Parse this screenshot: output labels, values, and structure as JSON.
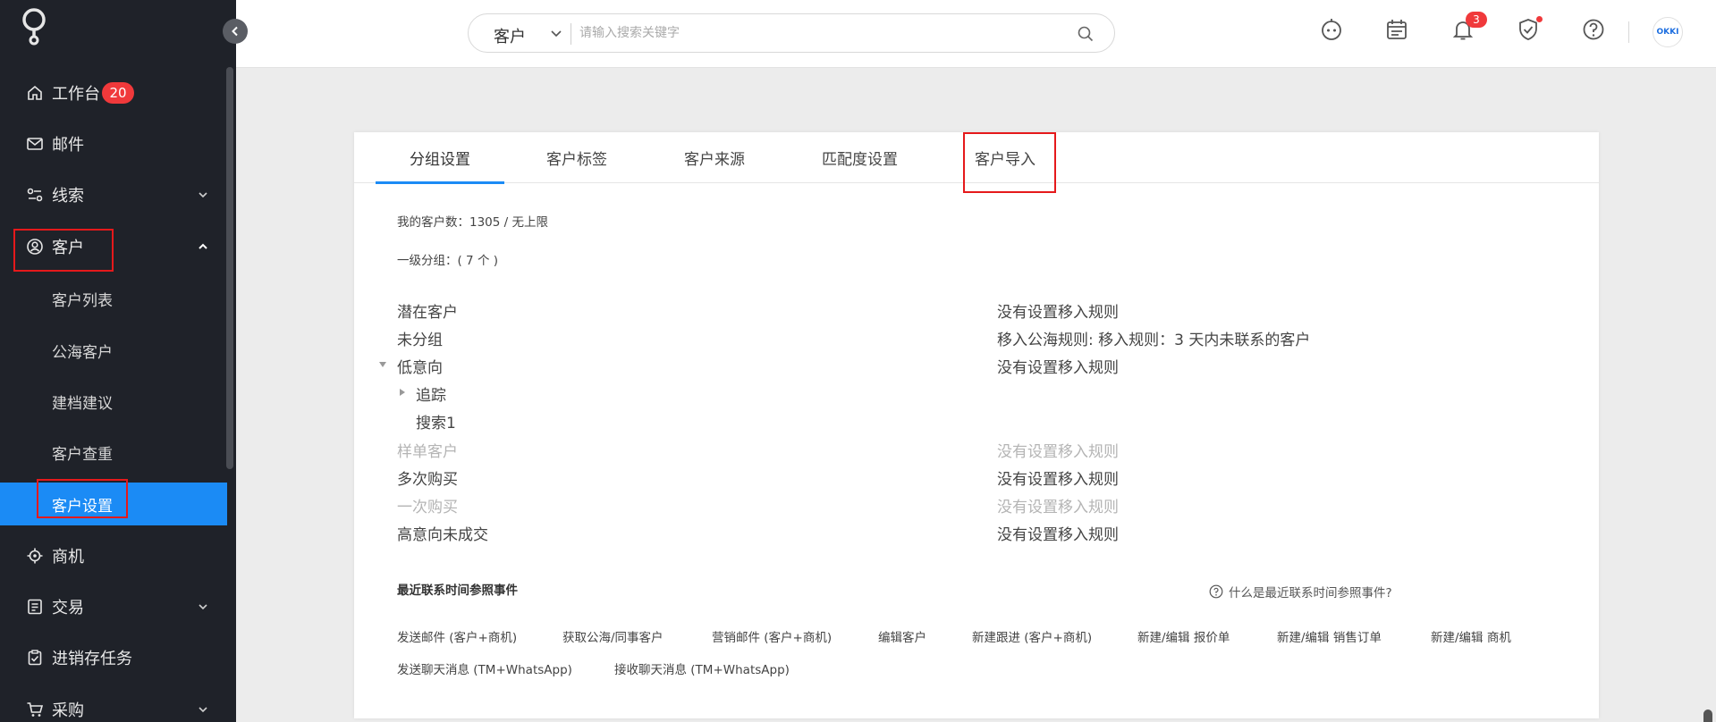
{
  "sidebar": {
    "logo_icon": "okki-logo-icon",
    "items": [
      {
        "label": "工作台",
        "icon": "home-icon",
        "badge": "20"
      },
      {
        "label": "邮件",
        "icon": "mail-icon"
      },
      {
        "label": "线索",
        "icon": "leads-icon",
        "chevron": "down"
      },
      {
        "label": "客户",
        "icon": "customer-icon",
        "chevron": "up"
      },
      {
        "label": "商机",
        "icon": "opportunity-icon"
      },
      {
        "label": "交易",
        "icon": "transaction-icon",
        "chevron": "down"
      },
      {
        "label": "进销存任务",
        "icon": "inventory-task-icon"
      },
      {
        "label": "采购",
        "icon": "cart-icon",
        "chevron": "down"
      }
    ],
    "sub_items": [
      "客户列表",
      "公海客户",
      "建档建议",
      "客户查重",
      "客户设置"
    ],
    "active_sub_item": "客户设置"
  },
  "topbar": {
    "search_scope": "客户",
    "search_placeholder": "请输入搜索关键字",
    "notification_count": "3",
    "avatar_text": "OKKI"
  },
  "tabs": [
    "分组设置",
    "客户标签",
    "客户来源",
    "匹配度设置",
    "客户导入"
  ],
  "active_tab": "分组设置",
  "stats": {
    "customer_count": "我的客户数：1305 / 无上限",
    "level1_groups": "一级分组：( 7 个 )"
  },
  "groups": [
    {
      "name": "潜在客户",
      "rule": "没有设置移入规则",
      "muted": false
    },
    {
      "name": "未分组",
      "rule": "移入公海规则: 移入规则：3 天内未联系的客户",
      "muted": false
    },
    {
      "name": "低意向",
      "rule": "没有设置移入规则",
      "muted": false,
      "expanded": true
    },
    {
      "name": "追踪",
      "rule": "",
      "muted": false,
      "child": true,
      "collapsed": true
    },
    {
      "name": "搜索1",
      "rule": "",
      "muted": false,
      "child": true
    },
    {
      "name": "样单客户",
      "rule": "没有设置移入规则",
      "muted": true
    },
    {
      "name": "多次购买",
      "rule": "没有设置移入规则",
      "muted": false
    },
    {
      "name": "一次购买",
      "rule": "没有设置移入规则",
      "muted": true
    },
    {
      "name": "高意向未成交",
      "rule": "没有设置移入规则",
      "muted": false
    }
  ],
  "events_section": {
    "title": "最近联系时间参照事件",
    "help_text": "什么是最近联系时间参照事件?",
    "events_row1": [
      "发送邮件 (客户+商机)",
      "获取公海/同事客户",
      "营销邮件 (客户+商机)",
      "编辑客户",
      "新建跟进 (客户+商机)",
      "新建/编辑 报价单",
      "新建/编辑 销售订单",
      "新建/编辑 商机"
    ],
    "events_row2": [
      "发送聊天消息 (TM+WhatsApp)",
      "接收聊天消息 (TM+WhatsApp)"
    ]
  },
  "colors": {
    "sidebar_bg": "#1f2229",
    "active_blue": "#1b8bf5",
    "badge_red": "#f0393b",
    "highlight_red": "#e5191b"
  }
}
